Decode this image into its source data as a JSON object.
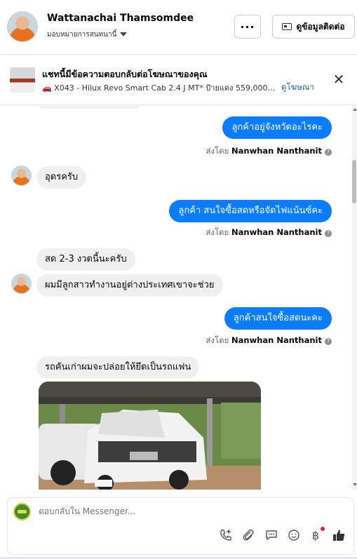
{
  "header": {
    "user_name": "Wattanachai Thamsomdee",
    "assign_label": "มอบหมายการสนทนานี้",
    "more_label": "···",
    "contact_label": "ดูข้อมูลติดต่อ"
  },
  "ad_banner": {
    "title": "แชทนี้มีข้อความตอบกลับต่อโฆษณาของคุณ",
    "subtitle": "🚗 X043 - Hilux Revo Smart Cab 2.4 J MT* ป้ายแดง 559,000 บาท ...",
    "view_ad_label": "ดูโฆษณา",
    "close_label": "✕"
  },
  "messages": [
    {
      "direction": "out",
      "text": "ลูกค้าอยู่จังหวัดอะไรคะ",
      "sent_by_prefix": "ส่งโดย",
      "sent_by_name": "Nanwhan Nanthanit"
    },
    {
      "direction": "in",
      "text": "อุดรครับ"
    },
    {
      "direction": "out",
      "text": "ลูกค้า สนใจซื้อสดหรือจัดไฟแน้นซ์คะ",
      "sent_by_prefix": "ส่งโดย",
      "sent_by_name": "Nanwhan Nanthanit"
    },
    {
      "direction": "in",
      "text": "สด 2-3 งวดนี้นะครับ"
    },
    {
      "direction": "in",
      "text": "ผมมีลูกสาวทำงานอยู่ต่างประเทศเขาจะช่วย"
    },
    {
      "direction": "out",
      "text": "ลูกค้าสนใจซื้อสดนะคะ",
      "sent_by_prefix": "ส่งโดย",
      "sent_by_name": "Nanwhan Nanthanit"
    },
    {
      "direction": "in",
      "text": "รถคันเก่าผมจะปล่อยให้ยึดเป็นรถแฟน"
    }
  ],
  "composer": {
    "placeholder": "ตอบกลับใน Messenger..."
  },
  "icons": {
    "colors": {
      "outgoing_bubble": "#0a7cff",
      "incoming_bubble": "#f0f0f0",
      "link": "#1a5fb4",
      "notification_dot": "#e41e3f"
    }
  }
}
